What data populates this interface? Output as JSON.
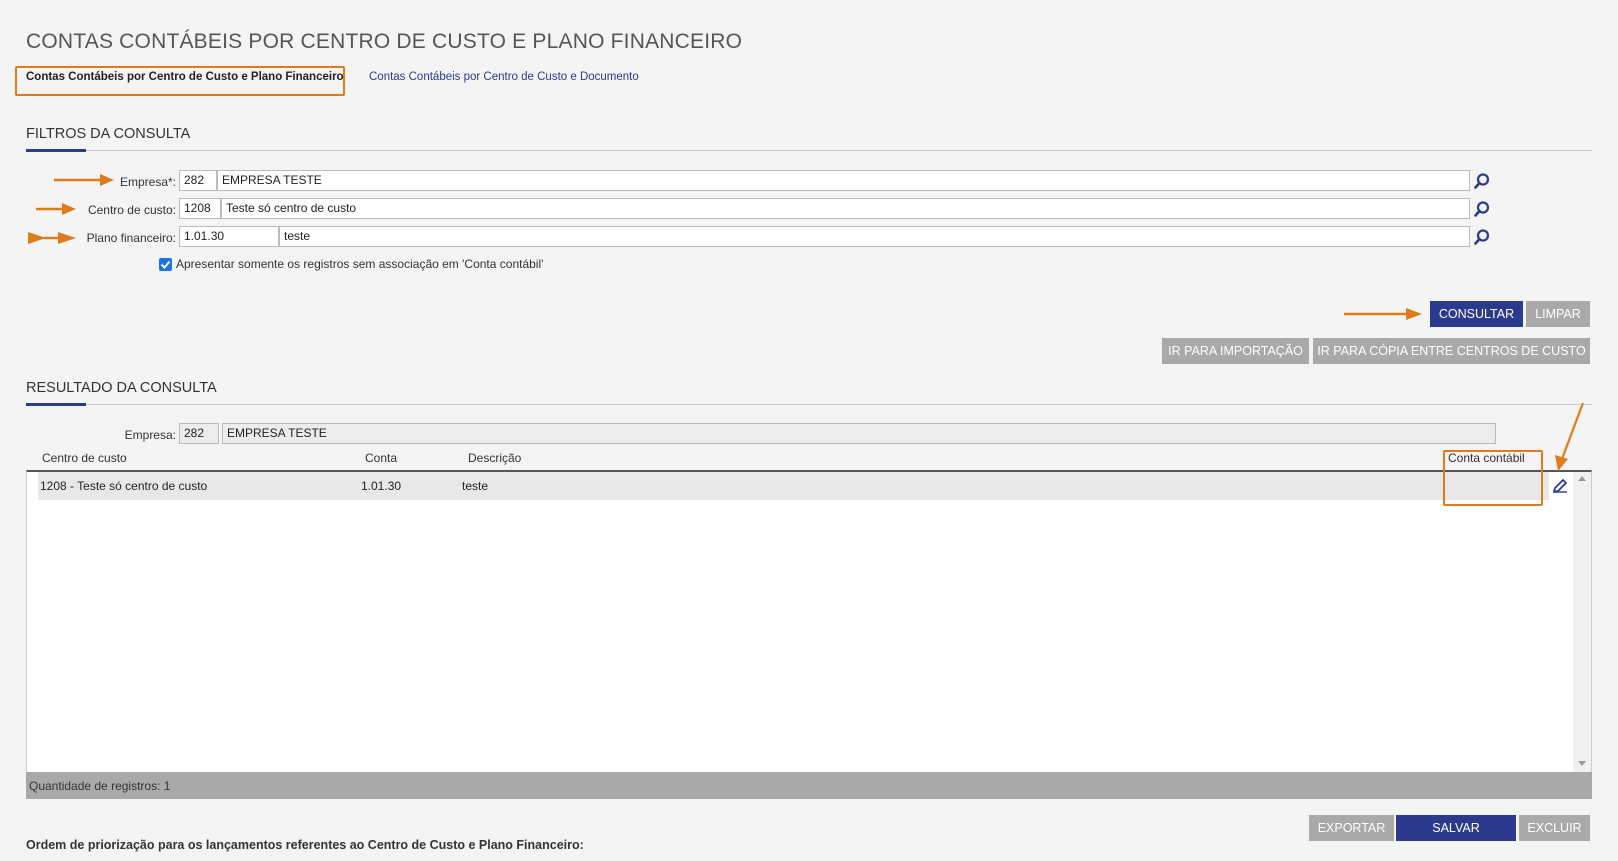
{
  "page": {
    "title": "CONTAS CONTÁBEIS POR CENTRO DE CUSTO E PLANO FINANCEIRO"
  },
  "tabs": [
    {
      "label": "Contas Contábeis por Centro de Custo e Plano Financeiro",
      "active": true
    },
    {
      "label": "Contas Contábeis por Centro de Custo e Documento",
      "active": false
    }
  ],
  "filters": {
    "title": "FILTROS DA CONSULTA",
    "empresa": {
      "label": "Empresa*:",
      "code": "282",
      "name": "EMPRESA TESTE"
    },
    "centro_custo": {
      "label": "Centro de custo:",
      "code": "1208",
      "name": "Teste só centro de custo"
    },
    "plano_financeiro": {
      "label": "Plano financeiro:",
      "code": "1.01.30",
      "name": "teste"
    },
    "checkbox": {
      "label": "Apresentar somente os registros sem associação em 'Conta contábil'",
      "checked": true
    }
  },
  "buttons": {
    "consultar": "CONSULTAR",
    "limpar": "LIMPAR",
    "importacao": "IR PARA IMPORTAÇÃO",
    "copia": "IR PARA CÓPIA ENTRE CENTROS DE CUSTO",
    "exportar": "EXPORTAR",
    "salvar": "SALVAR",
    "excluir": "EXCLUIR"
  },
  "results": {
    "title": "RESULTADO DA CONSULTA",
    "empresa": {
      "label": "Empresa:",
      "code": "282",
      "name": "EMPRESA TESTE"
    },
    "columns": {
      "centro": "Centro de custo",
      "conta": "Conta",
      "descricao": "Descrição",
      "conta_contabil": "Conta contábil"
    },
    "rows": [
      {
        "centro": "1208 - Teste só centro de custo",
        "conta": "1.01.30",
        "descricao": "teste",
        "conta_contabil": ""
      }
    ],
    "footer": "Quantidade de registros: 1"
  },
  "priority_label": "Ordem de priorização para os lançamentos referentes ao Centro de Custo e Plano Financeiro:",
  "colors": {
    "primary": "#2b3a8c",
    "annotation": "#e07b1a",
    "gray_button": "#a9a9a9"
  },
  "icons": {
    "search": "search-icon",
    "edit": "pencil-icon"
  }
}
